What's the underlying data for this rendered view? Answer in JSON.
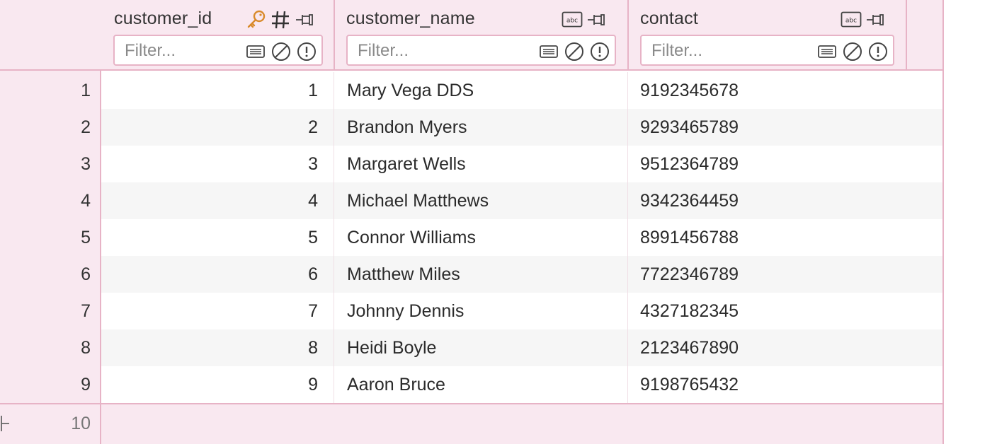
{
  "columns": [
    {
      "name": "customer_id",
      "filter_placeholder": "Filter...",
      "icons": [
        "key-icon",
        "hash-icon",
        "pin-icon"
      ]
    },
    {
      "name": "customer_name",
      "filter_placeholder": "Filter...",
      "icons": [
        "text-type-icon",
        "pin-icon"
      ]
    },
    {
      "name": "contact",
      "filter_placeholder": "Filter...",
      "icons": [
        "text-type-icon",
        "pin-icon"
      ]
    }
  ],
  "type_badge": "abc",
  "rows": [
    {
      "rownum": "1",
      "customer_id": "1",
      "customer_name": "Mary Vega DDS",
      "contact": "9192345678"
    },
    {
      "rownum": "2",
      "customer_id": "2",
      "customer_name": "Brandon Myers",
      "contact": "9293465789"
    },
    {
      "rownum": "3",
      "customer_id": "3",
      "customer_name": "Margaret Wells",
      "contact": "9512364789"
    },
    {
      "rownum": "4",
      "customer_id": "4",
      "customer_name": "Michael Matthews",
      "contact": "9342364459"
    },
    {
      "rownum": "5",
      "customer_id": "5",
      "customer_name": "Connor Williams",
      "contact": "8991456788"
    },
    {
      "rownum": "6",
      "customer_id": "6",
      "customer_name": "Matthew Miles",
      "contact": "7722346789"
    },
    {
      "rownum": "7",
      "customer_id": "7",
      "customer_name": "Johnny Dennis",
      "contact": "4327182345"
    },
    {
      "rownum": "8",
      "customer_id": "8",
      "customer_name": "Heidi Boyle",
      "contact": "2123467890"
    },
    {
      "rownum": "9",
      "customer_id": "9",
      "customer_name": "Aaron Bruce",
      "contact": "9198765432"
    }
  ],
  "new_row_number": "10",
  "colors": {
    "header_bg": "#f9e8f0",
    "border": "#e7b3c6",
    "key_icon": "#d98a2b",
    "alt_row": "#f6f6f6"
  }
}
